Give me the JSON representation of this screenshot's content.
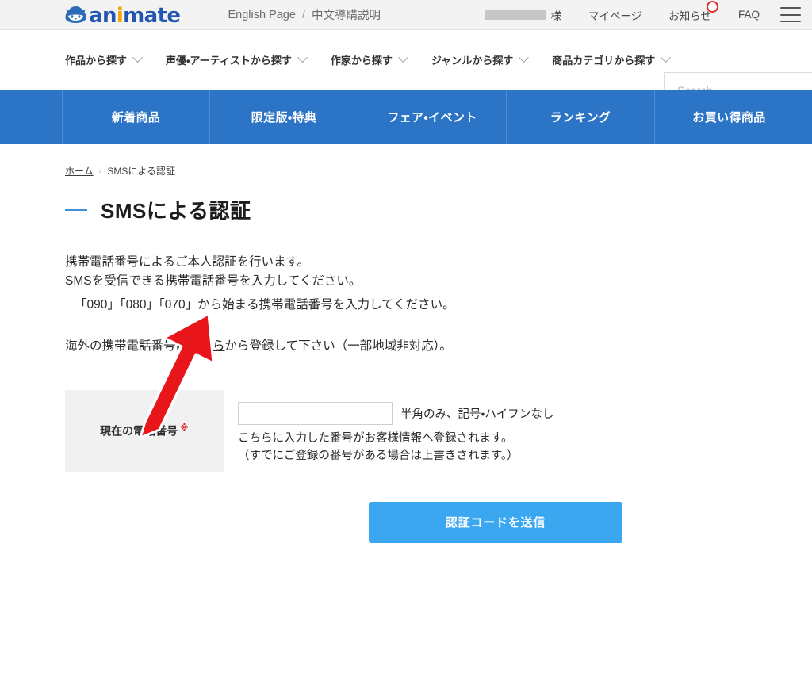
{
  "header": {
    "logo": {
      "icon": "animate-mascot-icon",
      "word_part1": "an",
      "word_i": "i",
      "word_part2": "mate"
    },
    "lang_english": "English Page",
    "lang_separator": "/",
    "lang_chinese": "中文導購説明",
    "user_suffix": "様",
    "links": [
      {
        "label": "マイページ",
        "name": "mypage"
      },
      {
        "label": "お知らせ",
        "name": "notifications",
        "badge": true
      },
      {
        "label": "FAQ",
        "name": "faq"
      }
    ],
    "menu_icon": "hamburger-menu-icon"
  },
  "category_nav": {
    "items": [
      {
        "label": "作品から探す"
      },
      {
        "label": "声優・アーティストから探す"
      },
      {
        "label": "作家から探す"
      },
      {
        "label": "ジャンルから探す"
      },
      {
        "label": "商品カテゴリから探す"
      }
    ],
    "search_placeholder": "Search",
    "search_value": ""
  },
  "primary_nav": {
    "items": [
      {
        "label": "新着商品"
      },
      {
        "label": "限定版・特典"
      },
      {
        "label": "フェア・イベント"
      },
      {
        "label": "ランキング"
      },
      {
        "label": "お買い得商品"
      }
    ]
  },
  "breadcrumb": {
    "home": "ホーム",
    "separator": "›",
    "current": "SMSによる認証"
  },
  "main": {
    "title": "SMSによる認証",
    "intro_line1": "携帯電話番号によるご本人認証を行います。",
    "intro_line2": "SMSを受信できる携帯電話番号を入力してください。",
    "intro_line3": "「090」「080」「070」から始まる携帯電話番号を入力してください。",
    "overseas_prefix": "海外の携帯電話番号は",
    "overseas_link": "こちら",
    "overseas_suffix": "から登録して下さい（一部地域非対応）。",
    "form": {
      "label": "現在の電話番号",
      "required_mark": "※",
      "input_value": "",
      "input_placeholder": "",
      "hint": "半角のみ、記号・ハイフンなし",
      "note_line1": "こちらに入力した番号がお客様情報へ登録されます。",
      "note_line2": "（すでにご登録の番号がある場合は上書きされます。）"
    },
    "submit_label": "認証コードを送信"
  },
  "annotation": {
    "arrow_color": "#e8161a",
    "arrow_target": "こちら"
  },
  "colors": {
    "primary_nav_blue": "#2c74c6",
    "submit_blue": "#3ba7f0",
    "brand_blue": "#2256b0",
    "brand_orange": "#f5a500",
    "title_dash_blue": "#3f8fd6",
    "badge_red": "#e02b2b",
    "label_cell_gray": "#f1f1f1",
    "utility_bar_gray": "#f3f3f3"
  }
}
